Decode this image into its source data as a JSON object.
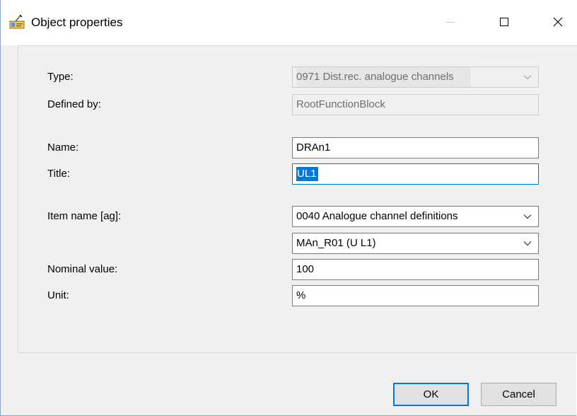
{
  "window": {
    "title": "Object properties",
    "controls": {
      "minimize": "minimize-icon",
      "maximize": "maximize-icon",
      "close": "close-icon"
    }
  },
  "form": {
    "type": {
      "label": "Type:",
      "value": "0971  Dist.rec. analogue channels"
    },
    "defined_by": {
      "label": "Defined by:",
      "value": "RootFunctionBlock"
    },
    "name": {
      "label": "Name:",
      "value": "DRAn1"
    },
    "title": {
      "label": "Title:",
      "value": "UL1"
    },
    "item_name": {
      "label": "Item name [ag]:",
      "value": "0040  Analogue channel definitions",
      "sub_value": "MAn_R01 (U L1)"
    },
    "nominal_value": {
      "label": "Nominal value:",
      "value": "100"
    },
    "unit": {
      "label": "Unit:",
      "value": "%"
    }
  },
  "buttons": {
    "ok": "OK",
    "cancel": "Cancel"
  },
  "colors": {
    "accent": "#0078d7",
    "panel": "#f0f0f0",
    "disabled_text": "#6d6d6d"
  }
}
